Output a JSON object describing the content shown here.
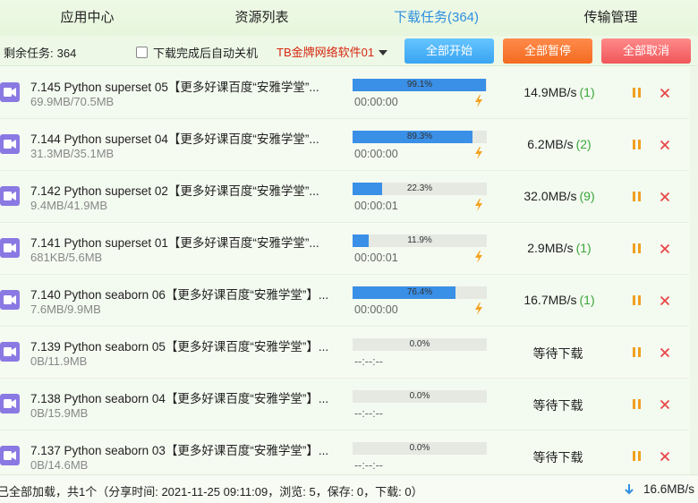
{
  "tabs": [
    {
      "label": "应用中心"
    },
    {
      "label": "资源列表"
    },
    {
      "label": "下载任务(364)"
    },
    {
      "label": "传输管理"
    }
  ],
  "toolbar": {
    "remaining_label": "剩余任务:",
    "remaining_count": "364",
    "auto_shutdown_label": "下载完成后自动关机",
    "source_select": "TB金牌网络软件01",
    "start_all": "全部开始",
    "pause_all": "全部暂停",
    "cancel_all": "全部取消"
  },
  "tasks": [
    {
      "name": "7.145 Python superset 05【更多好课百度“安雅学堂”...",
      "size": "69.9MB/70.5MB",
      "progress_text": "99.1%",
      "progress": 99.1,
      "time": "00:00:00",
      "speed": "14.9MB/s",
      "conns": "(1)",
      "waiting": false
    },
    {
      "name": "7.144 Python superset 04【更多好课百度“安雅学堂”...",
      "size": "31.3MB/35.1MB",
      "progress_text": "89.3%",
      "progress": 89.3,
      "time": "00:00:00",
      "speed": "6.2MB/s",
      "conns": "(2)",
      "waiting": false
    },
    {
      "name": "7.142 Python superset 02【更多好课百度“安雅学堂”...",
      "size": "9.4MB/41.9MB",
      "progress_text": "22.3%",
      "progress": 22.3,
      "time": "00:00:01",
      "speed": "32.0MB/s",
      "conns": "(9)",
      "waiting": false
    },
    {
      "name": "7.141 Python superset 01【更多好课百度“安雅学堂”...",
      "size": "681KB/5.6MB",
      "progress_text": "11.9%",
      "progress": 11.9,
      "time": "00:00:01",
      "speed": "2.9MB/s",
      "conns": "(1)",
      "waiting": false
    },
    {
      "name": "7.140 Python seaborn 06【更多好课百度“安雅学堂”】...",
      "size": "7.6MB/9.9MB",
      "progress_text": "76.4%",
      "progress": 76.4,
      "time": "00:00:00",
      "speed": "16.7MB/s",
      "conns": "(1)",
      "waiting": false
    },
    {
      "name": "7.139 Python seaborn 05【更多好课百度“安雅学堂”】...",
      "size": "0B/11.9MB",
      "progress_text": "0.0%",
      "progress": 0,
      "time": "--:--:--",
      "speed": "等待下载",
      "conns": "",
      "waiting": true
    },
    {
      "name": "7.138 Python seaborn 04【更多好课百度“安雅学堂”】...",
      "size": "0B/15.9MB",
      "progress_text": "0.0%",
      "progress": 0,
      "time": "--:--:--",
      "speed": "等待下载",
      "conns": "",
      "waiting": true
    },
    {
      "name": "7.137 Python seaborn 03【更多好课百度“安雅学堂”】...",
      "size": "0B/14.6MB",
      "progress_text": "0.0%",
      "progress": 0,
      "time": "--:--:--",
      "speed": "等待下载",
      "conns": "",
      "waiting": true
    }
  ],
  "status": {
    "text": "已全部加载，共1个（分享时间: 2021-11-25 09:11:09，浏览: 5，保存: 0，下载: 0）",
    "total_speed": "16.6MB/s"
  },
  "colors": {
    "accent": "#2f8fe0",
    "progress": "#3a8fe6",
    "connections": "#3aa63a",
    "pause_icon": "#f0a020",
    "close_icon": "#e84545",
    "source_text": "#d5260e"
  }
}
